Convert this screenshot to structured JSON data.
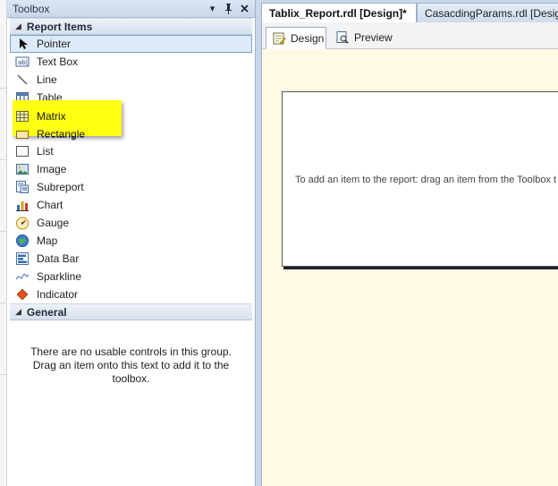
{
  "toolbox": {
    "title": "Toolbox",
    "controls": {
      "dropdown": "▾",
      "pin": "⊥",
      "close": "✕"
    },
    "groups": [
      {
        "label": "Report Items",
        "items": [
          {
            "label": "Pointer",
            "icon": "pointer-icon"
          },
          {
            "label": "Text Box",
            "icon": "textbox-icon"
          },
          {
            "label": "Line",
            "icon": "line-icon"
          },
          {
            "label": "Table",
            "icon": "table-icon"
          },
          {
            "label": "Matrix",
            "icon": "matrix-icon"
          },
          {
            "label": "Rectangle",
            "icon": "rectangle-icon"
          },
          {
            "label": "List",
            "icon": "list-icon"
          },
          {
            "label": "Image",
            "icon": "image-icon"
          },
          {
            "label": "Subreport",
            "icon": "subreport-icon"
          },
          {
            "label": "Chart",
            "icon": "chart-icon"
          },
          {
            "label": "Gauge",
            "icon": "gauge-icon"
          },
          {
            "label": "Map",
            "icon": "map-icon"
          },
          {
            "label": "Data Bar",
            "icon": "databar-icon"
          },
          {
            "label": "Sparkline",
            "icon": "sparkline-icon"
          },
          {
            "label": "Indicator",
            "icon": "indicator-icon"
          }
        ]
      },
      {
        "label": "General",
        "empty_text": "There are no usable controls in this group. Drag an item onto this text to add it to the toolbox."
      }
    ],
    "highlight_color": "#ffff00"
  },
  "document": {
    "tabs": [
      {
        "label": "Tablix_Report.rdl [Design]*",
        "active": true
      },
      {
        "label": "CasacdingParams.rdl [Design]",
        "active": false
      }
    ],
    "view_tabs": [
      {
        "label": "Design",
        "icon": "design-icon"
      },
      {
        "label": "Preview",
        "icon": "preview-icon"
      }
    ],
    "canvas_hint": "To add an item to the report: drag an item from the Toolbox t"
  },
  "colors": {
    "canvas_background": "#fff9e6",
    "selected_item": "#dceaf9",
    "frame": "#c9d7ea"
  }
}
